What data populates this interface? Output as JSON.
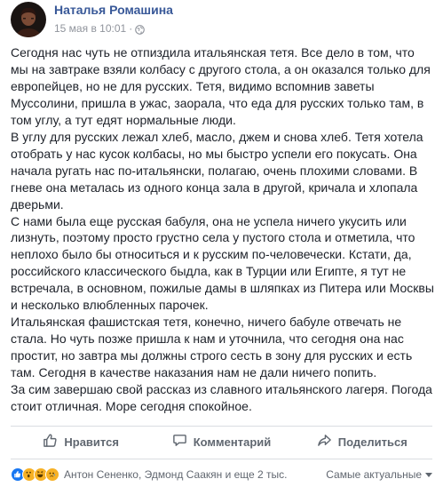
{
  "post": {
    "author": "Наталья Ромашина",
    "timestamp": "15 мая в 10:01",
    "separator": "·",
    "privacy_icon": "globe-icon",
    "paragraphs": [
      "Сегодня нас чуть не отпиздила итальянская тетя. Все дело в том, что мы на завтраке взяли колбасу с другого стола, а он оказался только для европейцев, но не для русских. Тетя, видимо вспомнив заветы Муссолини, пришла в ужас, заорала, что еда для русских только там, в том углу, а тут едят нормальные люди.",
      "В углу для русских лежал хлеб, масло, джем и снова хлеб. Тетя хотела отобрать у нас кусок колбасы, но мы быстро успели его покусать. Она начала ругать нас по-итальянски, полагаю, очень плохими словами. В гневе она металась из одного конца зала в другой, кричала и хлопала дверьми.",
      "С нами была еще русская бабуля, она не успела ничего укусить или лизнуть, поэтому просто грустно села у пустого стола и отметила, что неплохо было бы относиться и к русским по-человечески. Кстати, да, российского классического быдла, как в Турции или Египте, я тут не встречала, в основном, пожилые дамы в шляпках из Питера или Москвы и несколько влюбленных парочек.",
      "Итальянская фашистская тетя, конечно, ничего бабуле отвечать не стала. Но чуть позже пришла к нам и уточнила, что сегодня она нас простит, но завтра мы должны строго сесть в зону для русских и есть там. Сегодня в качестве наказания нам не дали ничего попить.",
      "За сим завершаю свой рассказ из славного итальянского лагеря. Погода стоит отличная. Море сегодня спокойное."
    ]
  },
  "actions": {
    "like": "Нравится",
    "comment": "Комментарий",
    "share": "Поделиться"
  },
  "reactions": {
    "icons": [
      "like-icon",
      "wow-icon",
      "haha-icon",
      "sad-icon"
    ],
    "summary": "Антон Сененко, Эдмонд Саакян и еще 2 тыс.",
    "sort_label": "Самые актуальные"
  },
  "colors": {
    "link": "#385898",
    "text": "#1d2129",
    "muted": "#90949c",
    "action": "#606770",
    "like_blue": "#1877f2",
    "reaction_yellow": "#f7b125"
  }
}
